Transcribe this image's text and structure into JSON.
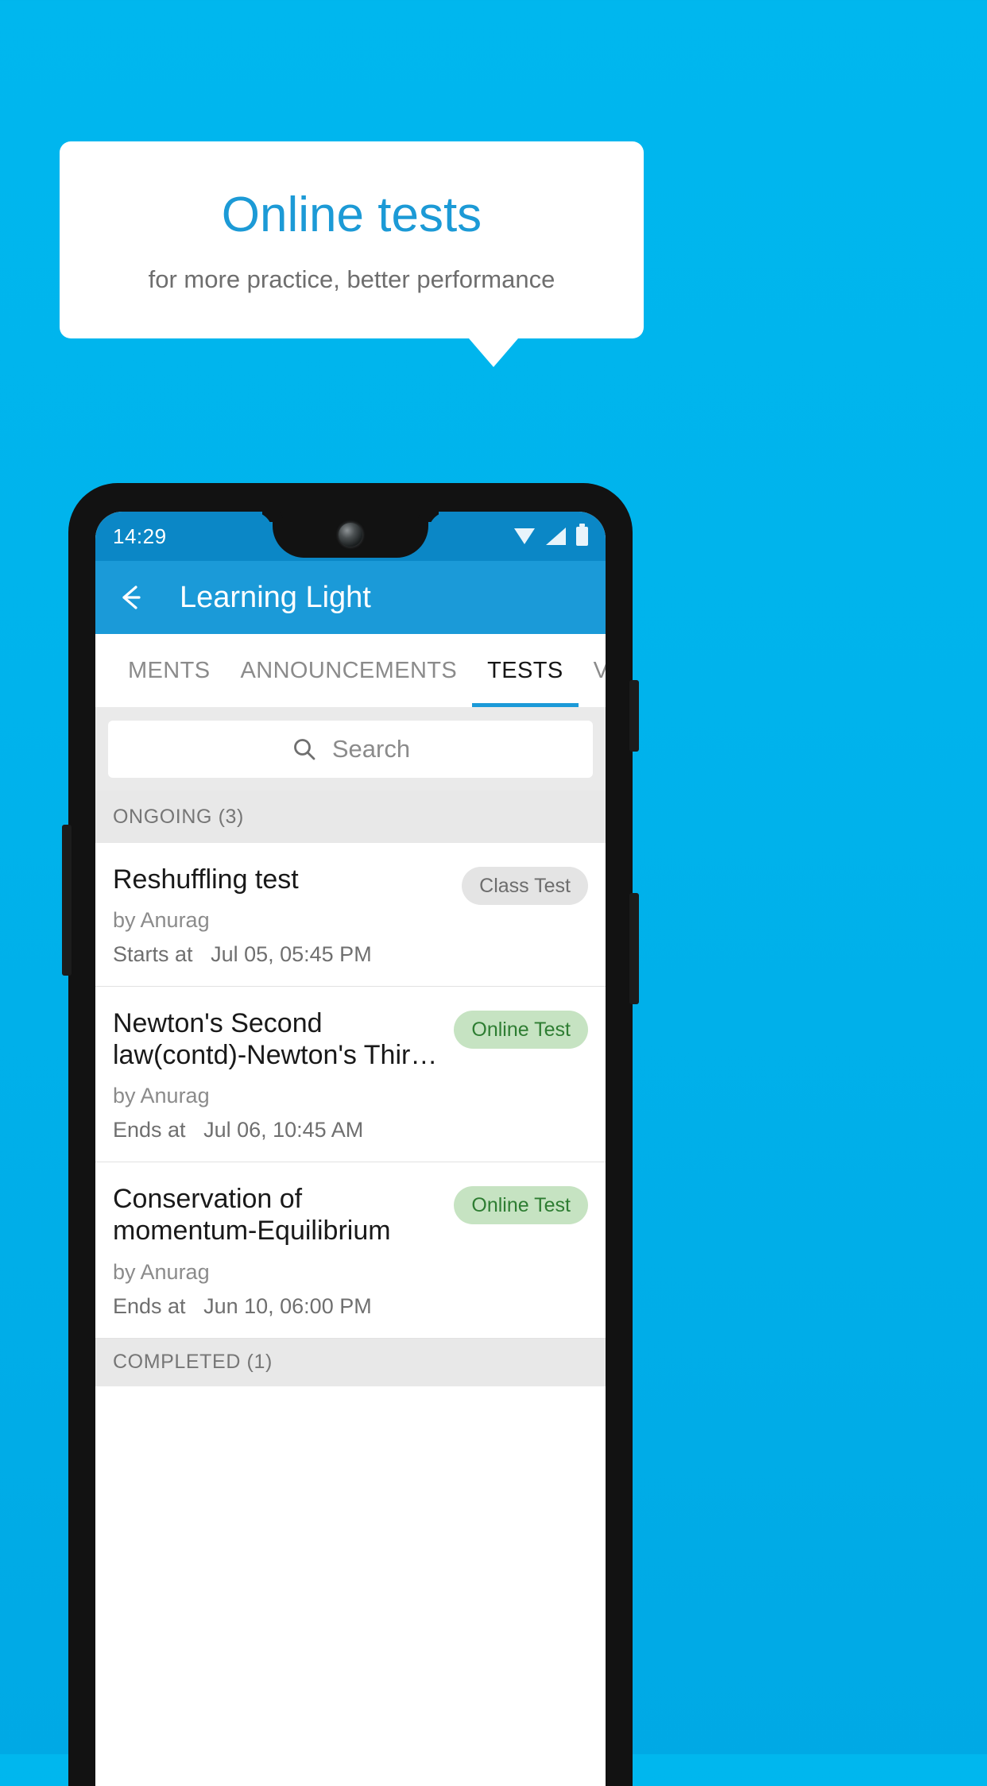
{
  "promo": {
    "title": "Online tests",
    "subtitle": "for more practice, better performance",
    "title_color": "#1c9ad6",
    "background_color": "#00b3ec"
  },
  "phone": {
    "statusbar": {
      "time": "14:29",
      "icons": [
        "wifi-icon",
        "signal-icon",
        "battery-icon"
      ],
      "background_color": "#0b87c6"
    },
    "appbar": {
      "back_icon": "back-arrow-icon",
      "title": "Learning Light",
      "background_color": "#1b9ad8"
    },
    "tabs": [
      {
        "label": "MENTS",
        "active": false
      },
      {
        "label": "ANNOUNCEMENTS",
        "active": false
      },
      {
        "label": "TESTS",
        "active": true
      },
      {
        "label": "VIDEOS",
        "active": false
      }
    ],
    "search": {
      "icon": "search-icon",
      "placeholder": "Search",
      "value": ""
    },
    "sections": [
      {
        "header": "ONGOING (3)"
      },
      {
        "header": "COMPLETED (1)"
      }
    ],
    "tests": [
      {
        "title": "Reshuffling test",
        "author": "by Anurag",
        "time_label": "Starts at",
        "time_value": "Jul 05, 05:45 PM",
        "badge": "Class Test",
        "badge_type": "gray"
      },
      {
        "title": "Newton's Second law(contd)-Newton's Thir…",
        "author": "by Anurag",
        "time_label": "Ends at",
        "time_value": "Jul 06, 10:45 AM",
        "badge": "Online Test",
        "badge_type": "green"
      },
      {
        "title": "Conservation of momentum-Equilibrium",
        "author": "by Anurag",
        "time_label": "Ends at",
        "time_value": "Jun 10, 06:00 PM",
        "badge": "Online Test",
        "badge_type": "green"
      }
    ]
  }
}
